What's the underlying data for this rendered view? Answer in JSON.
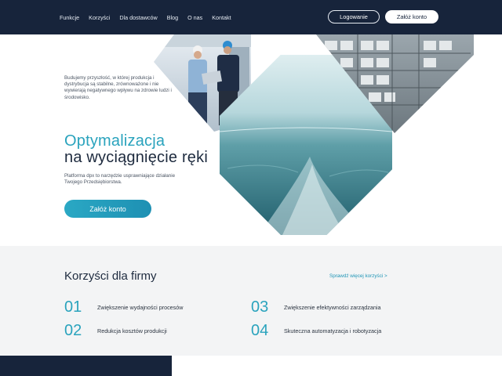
{
  "nav": {
    "links": [
      "Funkcje",
      "Korzyści",
      "Dla dostawców",
      "Blog",
      "O nas",
      "Kontakt"
    ],
    "login_label": "Logowanie",
    "signup_label": "Załóż konto"
  },
  "hero": {
    "tagline": "Budujemy przyszłość, w której produkcja i dystrybucja są stabilne, zrównoważone i nie wywierają negatywnego wpływu na zdrowie ludzi i środowisko.",
    "title_line1": "Optymalizacja",
    "title_line2": "na wyciągnięcie ręki",
    "description": "Platforma dpx to narzędzie usprawniające działanie Twojego Przedsiębiorstwa.",
    "cta_label": "Załóż konto"
  },
  "benefits": {
    "title": "Korzyści dla firmy",
    "more_link": "Sprawdź więcej korzyści >",
    "items": [
      {
        "num": "01",
        "text": "Zwiększenie wydajności procesów"
      },
      {
        "num": "02",
        "text": "Redukcja kosztów produkcji"
      },
      {
        "num": "03",
        "text": "Zwiększenie efektywności zarządzania"
      },
      {
        "num": "04",
        "text": "Skuteczna automatyzacja i robotyzacja"
      }
    ]
  },
  "colors": {
    "navy": "#17243b",
    "accent": "#2aa3bd",
    "section_bg": "#f3f4f5"
  }
}
